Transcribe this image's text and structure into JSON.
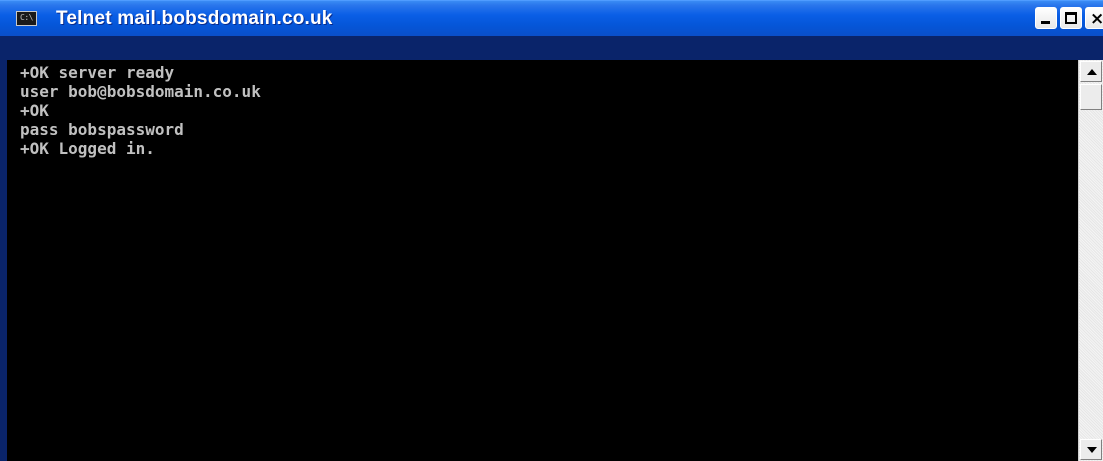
{
  "window": {
    "title": "Telnet mail.bobsdomain.co.uk",
    "icon": "console-icon",
    "icon_glyph": "C:\\",
    "close_glyph": "×"
  },
  "console": {
    "lines": [
      "+OK server ready",
      "user bob@bobsdomain.co.uk",
      "+OK",
      "pass bobspassword",
      "+OK Logged in."
    ]
  },
  "colors": {
    "titlebar": "#0a5ee6",
    "console_bg": "#000000",
    "console_text": "#c0c0c0"
  }
}
